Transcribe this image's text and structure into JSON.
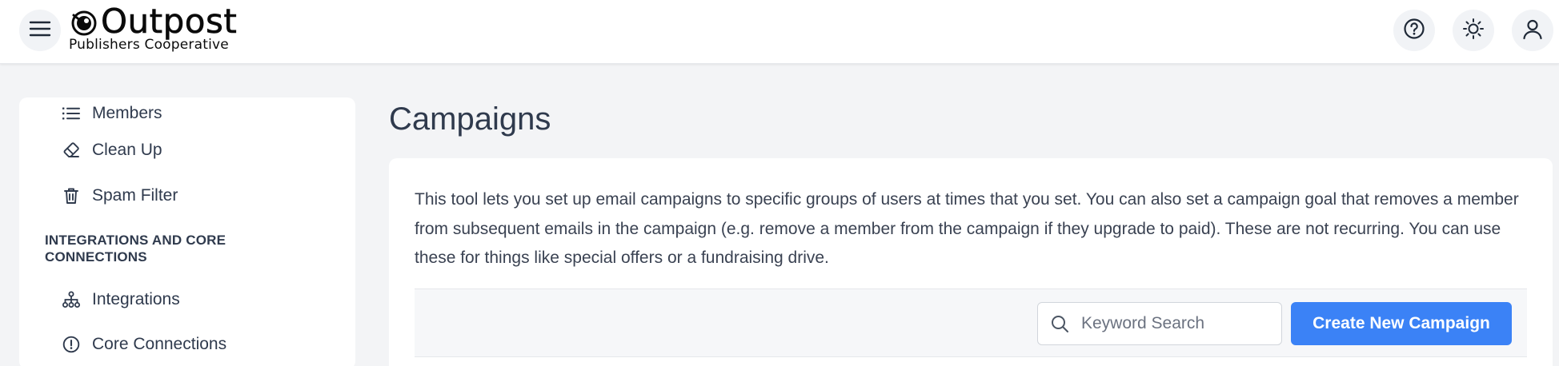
{
  "header": {
    "brand_title": "Outpost",
    "brand_subtitle": "Publishers Cooperative",
    "menu_icon": "hamburger-menu-icon",
    "help_icon": "question-circle-icon",
    "theme_icon": "sun-icon",
    "account_icon": "user-icon"
  },
  "sidebar": {
    "items_top": [
      {
        "label": "Members",
        "icon": "list-icon"
      },
      {
        "label": "Clean Up",
        "icon": "eraser-icon"
      },
      {
        "label": "Spam Filter",
        "icon": "trash-icon"
      }
    ],
    "section_title": "INTEGRATIONS AND CORE CONNECTIONS",
    "items_bottom": [
      {
        "label": "Integrations",
        "icon": "sitemap-icon"
      },
      {
        "label": "Core Connections",
        "icon": "alert-circle-icon"
      }
    ]
  },
  "main": {
    "title": "Campaigns",
    "description": "This tool lets you set up email campaigns to specific groups of users at times that you set. You can also set a campaign goal that removes a member from subsequent emails in the campaign (e.g. remove a member from the campaign if they upgrade to paid). These are not recurring. You can use these for things like special offers or a fundraising drive.",
    "search": {
      "placeholder": "Keyword Search",
      "value": ""
    },
    "create_button": "Create New Campaign"
  },
  "colors": {
    "accent": "#3b82f6",
    "page_background": "#f3f4f6",
    "text": "#2f3a4d"
  }
}
